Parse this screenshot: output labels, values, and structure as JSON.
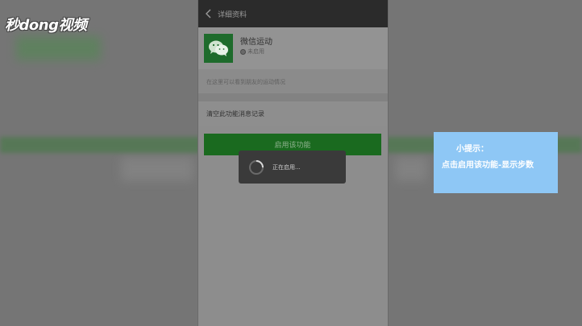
{
  "logo": {
    "text": "秒dong视频"
  },
  "titlebar": {
    "back_icon": "chevron-left-icon",
    "title": "详细资料"
  },
  "profile": {
    "name": "微信运动",
    "status": "未启用",
    "icon": "wechat-icon"
  },
  "description": "在这里可以看到朋友的运动情况",
  "clear_history": "清空此功能消息记录",
  "enable_button": "启用该功能",
  "loading": {
    "text": "正在启用..."
  },
  "tip": {
    "title": "小提示：",
    "body": "点击启用该功能-显示步数"
  },
  "colors": {
    "button_green": "#1a6a1f",
    "tip_blue": "#8ec7f5",
    "titlebar": "#2b2b2b"
  }
}
